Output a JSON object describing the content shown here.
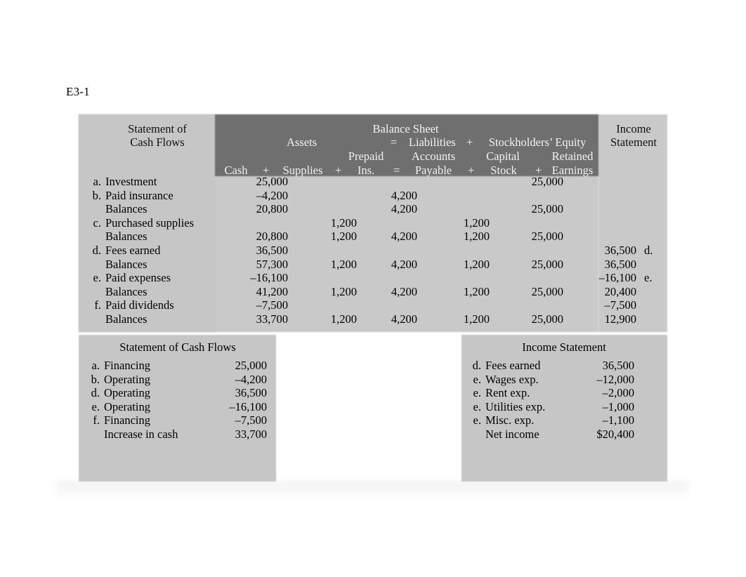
{
  "exercise": {
    "label": "E3-1"
  },
  "worksheet": {
    "headers": {
      "statement_of_cash_flows": "Statement of\nCash Flows",
      "statement_of_cash_flows_line1": "Statement of",
      "statement_of_cash_flows_line2": "Cash Flows",
      "balance_sheet": "Balance Sheet",
      "assets": "Assets",
      "equals": "=",
      "liabilities": "Liabilities",
      "plus": "+",
      "stockholders_equity": "Stockholders’ Equity",
      "income_statement_line1": "Income",
      "income_statement_line2": "Statement",
      "col_prepaid": "Prepaid",
      "col_accounts": "Accounts",
      "col_capital": "Capital",
      "col_retained": "Retained",
      "col_cash": "Cash",
      "col_supplies": "Supplies",
      "col_ins": "Ins.",
      "col_payable": "Payable",
      "col_stock": "Stock",
      "col_earnings": "Earnings",
      "op_plus_1": "+",
      "op_plus_2": "+",
      "op_equals_2": "=",
      "op_plus_3": "+",
      "op_plus_4": "+"
    },
    "rows": [
      {
        "mark": "a.",
        "label": "Investment",
        "cash": "25,000",
        "supplies": "",
        "prepaid": "",
        "payable": "",
        "stock": "25,000",
        "earnings": "",
        "is_mark": ""
      },
      {
        "mark": "b.",
        "label": "Paid insurance",
        "cash": "–4,200",
        "supplies": "",
        "prepaid": "4,200",
        "payable": "",
        "stock": "",
        "earnings": "",
        "is_mark": ""
      },
      {
        "mark": "",
        "label": "Balances",
        "cash": "20,800",
        "supplies": "",
        "prepaid": "4,200",
        "payable": "",
        "stock": "25,000",
        "earnings": "",
        "is_mark": ""
      },
      {
        "mark": "c.",
        "label": "Purchased supplies",
        "cash": "",
        "supplies": "1,200",
        "prepaid": "",
        "payable": "1,200",
        "stock": "",
        "earnings": "",
        "is_mark": ""
      },
      {
        "mark": "",
        "label": "Balances",
        "cash": "20,800",
        "supplies": "1,200",
        "prepaid": "4,200",
        "payable": "1,200",
        "stock": "25,000",
        "earnings": "",
        "is_mark": ""
      },
      {
        "mark": "d.",
        "label": "Fees earned",
        "cash": "36,500",
        "supplies": "",
        "prepaid": "",
        "payable": "",
        "stock": "",
        "earnings": "36,500",
        "is_mark": "d."
      },
      {
        "mark": "",
        "label": "Balances",
        "cash": "57,300",
        "supplies": "1,200",
        "prepaid": "4,200",
        "payable": "1,200",
        "stock": "25,000",
        "earnings": "36,500",
        "is_mark": ""
      },
      {
        "mark": "e.",
        "label": "Paid expenses",
        "cash": "–16,100",
        "supplies": "",
        "prepaid": "",
        "payable": "",
        "stock": "",
        "earnings": "–16,100",
        "is_mark": "e."
      },
      {
        "mark": "",
        "label": "Balances",
        "cash": "41,200",
        "supplies": "1,200",
        "prepaid": "4,200",
        "payable": "1,200",
        "stock": "25,000",
        "earnings": "20,400",
        "is_mark": ""
      },
      {
        "mark": "f.",
        "label": "Paid dividends",
        "cash": "–7,500",
        "supplies": "",
        "prepaid": "",
        "payable": "",
        "stock": "",
        "earnings": "–7,500",
        "is_mark": ""
      },
      {
        "mark": "",
        "label": "Balances",
        "cash": "33,700",
        "supplies": "1,200",
        "prepaid": "4,200",
        "payable": "1,200",
        "stock": "25,000",
        "earnings": "12,900",
        "is_mark": ""
      }
    ]
  },
  "cash_flows_panel": {
    "title": "Statement of Cash Flows",
    "rows": [
      {
        "mark": "a.",
        "label": "Financing",
        "amount": "25,000"
      },
      {
        "mark": "b.",
        "label": "Operating",
        "amount": "–4,200"
      },
      {
        "mark": "d.",
        "label": "Operating",
        "amount": "36,500"
      },
      {
        "mark": "e.",
        "label": "Operating",
        "amount": "–16,100"
      },
      {
        "mark": "f.",
        "label": "Financing",
        "amount": "–7,500"
      },
      {
        "mark": "",
        "label": "Increase in cash",
        "amount": "33,700"
      }
    ]
  },
  "income_statement_panel": {
    "title": "Income Statement",
    "rows": [
      {
        "mark": "d.",
        "label": "Fees earned",
        "amount": "36,500"
      },
      {
        "mark": "e.",
        "label": "Wages exp.",
        "amount": "–12,000"
      },
      {
        "mark": "e.",
        "label": "Rent exp.",
        "amount": "–2,000"
      },
      {
        "mark": "e.",
        "label": "Utilities exp.",
        "amount": "–1,000"
      },
      {
        "mark": "e.",
        "label": "Misc. exp.",
        "amount": "–1,100"
      },
      {
        "mark": "",
        "label": "Net income",
        "amount": "$20,400"
      }
    ]
  },
  "colors": {
    "panel_gray": "#c6c6c6",
    "band_dark_gray": "#6f6f6f",
    "text_dark": "#111111",
    "text_light": "#f2f2f2",
    "page_background": "#ffffff"
  }
}
